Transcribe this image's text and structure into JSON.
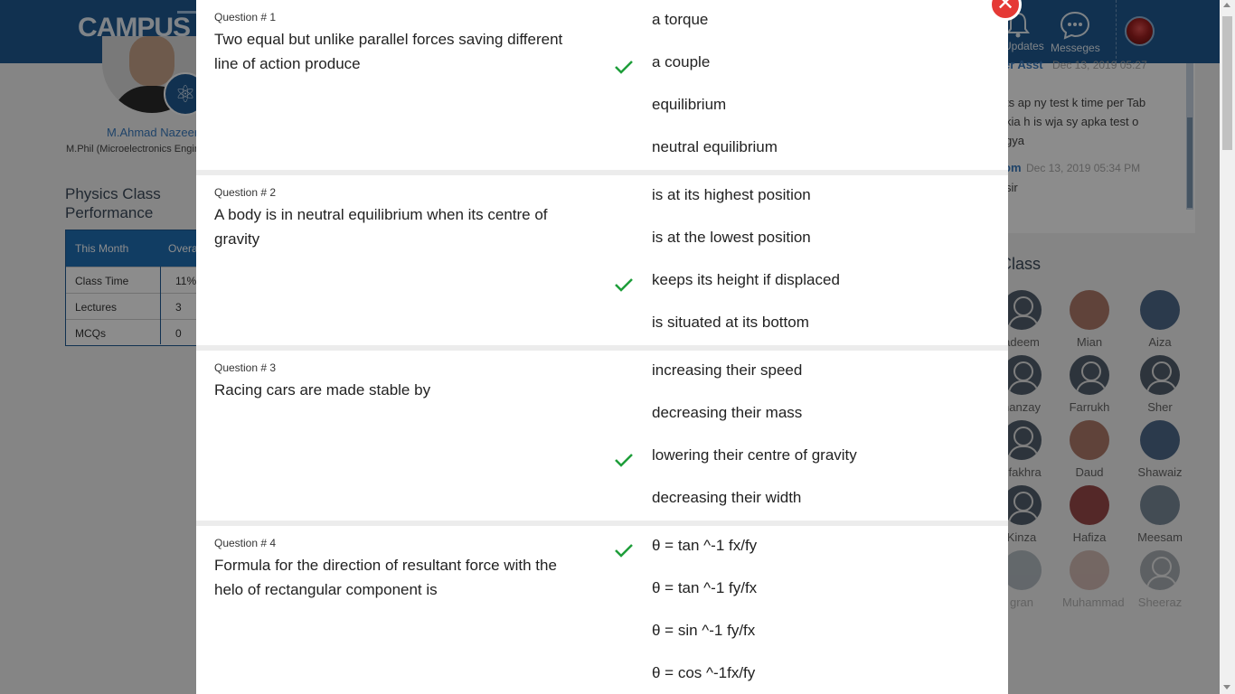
{
  "brand": {
    "logo_text": "CAMPUS"
  },
  "header": {
    "updates_label": "Updates",
    "messages_label": "Messeges"
  },
  "profile": {
    "name": "M.Ahmad Nazeer",
    "subtitle": "M.Phil (Microelectronics Engineering)"
  },
  "performance": {
    "title": "Physics Class Performance",
    "columns": [
      "This Month",
      "Overall"
    ],
    "rows": [
      {
        "label": "Class Time",
        "value": "11%"
      },
      {
        "label": "Lectures",
        "value": "3"
      },
      {
        "label": "MCQs",
        "value": "0"
      }
    ]
  },
  "chat": {
    "messages": [
      {
        "name": "er Asst",
        "date": "Dec 13, 2019 05:27",
        "text": "ts ap ny test k time per Tab kia h is wja sy apka test o gya"
      },
      {
        "name": "om",
        "date": "Dec 13, 2019 05:34 PM",
        "text": "sir"
      }
    ]
  },
  "class_section": {
    "title": "Class",
    "students": [
      {
        "name": "adeem",
        "photo": "generic"
      },
      {
        "name": "Mian",
        "photo": "photo"
      },
      {
        "name": "Aiza",
        "photo": "photo"
      },
      {
        "name": "hanzay",
        "photo": "generic"
      },
      {
        "name": "Farrukh",
        "photo": "generic"
      },
      {
        "name": "Sher",
        "photo": "generic"
      },
      {
        "name": "ufakhra",
        "photo": "generic"
      },
      {
        "name": "Daud",
        "photo": "photo"
      },
      {
        "name": "Shawaiz",
        "photo": "photo"
      },
      {
        "name": "Kinza",
        "photo": "generic"
      },
      {
        "name": "Hafiza",
        "photo": "photo"
      },
      {
        "name": "Meesam",
        "photo": "photo"
      },
      {
        "name": "gran",
        "photo": "photo"
      },
      {
        "name": "Muhammad",
        "photo": "photo"
      },
      {
        "name": "Sheeraz",
        "photo": "generic"
      }
    ]
  },
  "quiz": {
    "questions": [
      {
        "number": "Question # 1",
        "text": "Two equal but unlike parallel forces saving different line of action produce",
        "options": [
          "a torque",
          "a couple",
          "equilibrium",
          "neutral equilibrium"
        ],
        "correct_index": 1
      },
      {
        "number": "Question # 2",
        "text": "A body is in neutral equilibrium when its centre of gravity",
        "options": [
          "is at its highest position",
          "is at the lowest position",
          "keeps its height if displaced",
          "is situated at its bottom"
        ],
        "correct_index": 2
      },
      {
        "number": "Question # 3",
        "text": "Racing cars are made stable by",
        "options": [
          "increasing their speed",
          "decreasing their mass",
          "lowering their centre of gravity",
          "decreasing their width"
        ],
        "correct_index": 2
      },
      {
        "number": "Question # 4",
        "text": "Formula for the direction of resultant force with the helo of rectangular component is",
        "options": [
          "θ = tan ^-1 fx/fy",
          "θ = tan ^-1 fy/fx",
          "θ = sin ^-1 fy/fx",
          "θ = cos ^-1fx/fy"
        ],
        "correct_index": 0
      }
    ]
  },
  "colors": {
    "brand_blue": "#1f5a92",
    "check_green": "#1e9e3a",
    "close_red": "#e53935"
  }
}
